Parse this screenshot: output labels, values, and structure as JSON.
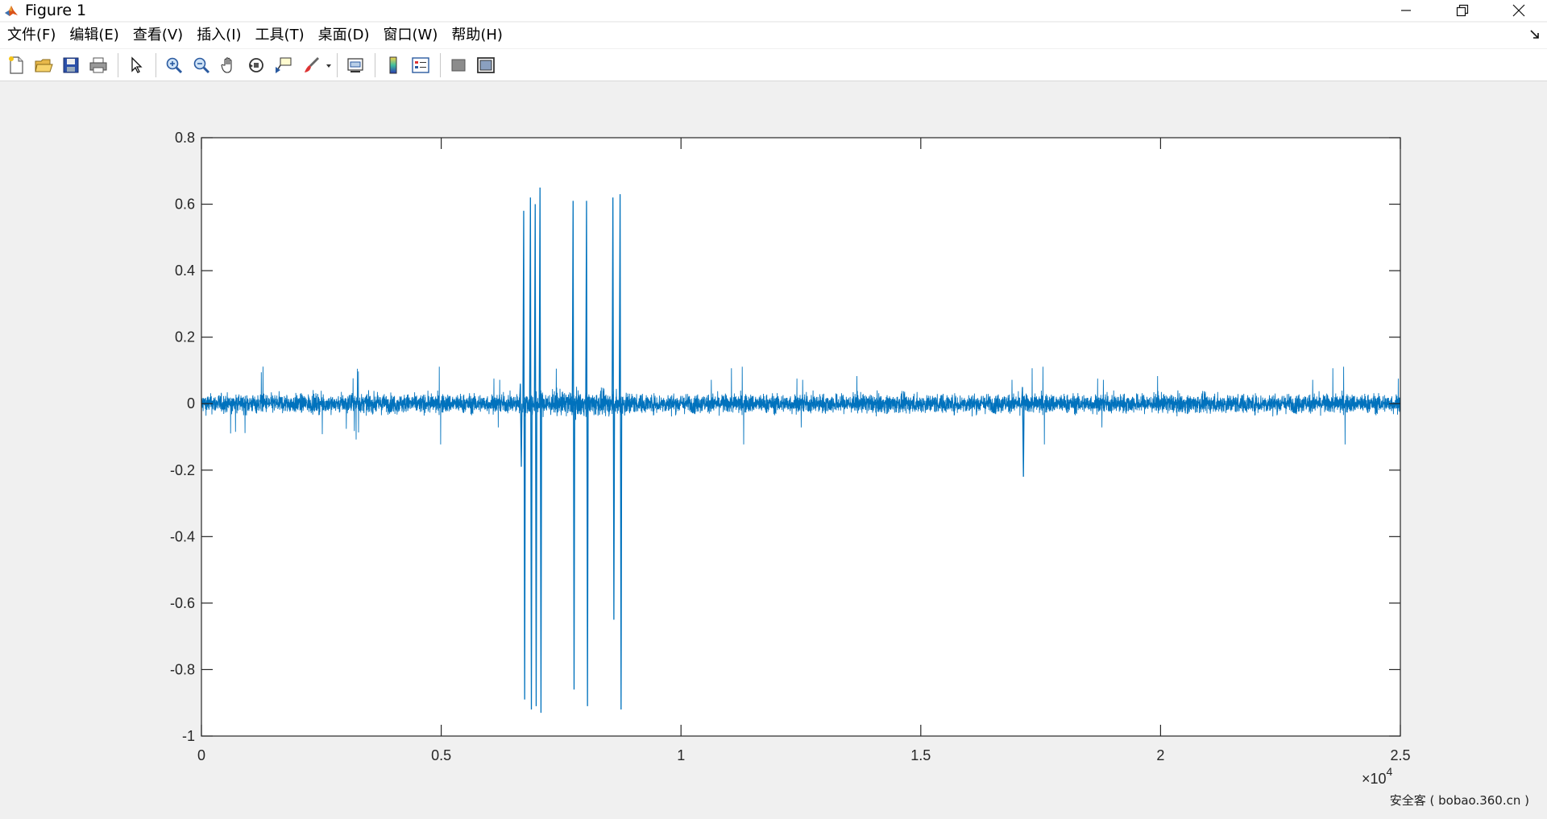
{
  "window": {
    "title": "Figure 1",
    "app_icon": "matlab-icon",
    "controls": [
      "minimize-icon",
      "restore-icon",
      "close-icon"
    ]
  },
  "menu": {
    "items": [
      {
        "label": "文件(F)"
      },
      {
        "label": "编辑(E)"
      },
      {
        "label": "查看(V)"
      },
      {
        "label": "插入(I)"
      },
      {
        "label": "工具(T)"
      },
      {
        "label": "桌面(D)"
      },
      {
        "label": "窗口(W)"
      },
      {
        "label": "帮助(H)"
      }
    ]
  },
  "toolbar": {
    "buttons": [
      "new-figure-icon",
      "open-file-icon",
      "save-icon",
      "print-icon",
      "separator",
      "edit-plot-arrow-icon",
      "separator",
      "zoom-in-icon",
      "zoom-out-icon",
      "pan-hand-icon",
      "rotate-3d-icon",
      "data-cursor-icon",
      "brush-icon",
      "separator",
      "link-plot-icon",
      "separator",
      "insert-colorbar-icon",
      "insert-legend-icon",
      "separator",
      "hide-plot-tools-icon",
      "show-plot-tools-icon"
    ]
  },
  "colors": {
    "series": "#0072bd",
    "axes": "#262626",
    "background": "#f0f0f0",
    "plot_bg": "#ffffff"
  },
  "chart_data": {
    "type": "line",
    "title": "",
    "xlabel": "",
    "ylabel": "",
    "xlim": [
      0,
      25000
    ],
    "ylim": [
      -1,
      0.8
    ],
    "xticks": [
      0,
      5000,
      10000,
      15000,
      20000,
      25000
    ],
    "xtick_labels": [
      "0",
      "0.5",
      "1",
      "1.5",
      "2",
      "2.5"
    ],
    "x_exponent_label": "×10",
    "x_exponent_power": "4",
    "yticks": [
      -1,
      -0.8,
      -0.6,
      -0.4,
      -0.2,
      0,
      0.2,
      0.4,
      0.6,
      0.8
    ],
    "ytick_labels": [
      "-1",
      "-0.8",
      "-0.6",
      "-0.4",
      "-0.2",
      "0",
      "0.2",
      "0.4",
      "0.6",
      "0.8"
    ],
    "grid": false,
    "legend": "none",
    "series": [
      {
        "noise_segments": [
          {
            "x_start": 0,
            "x_end": 6650,
            "amplitude": 0.055
          },
          {
            "x_start": 6700,
            "x_end": 9000,
            "amplitude": 0.07
          },
          {
            "x_start": 9000,
            "x_end": 25000,
            "amplitude": 0.055
          }
        ],
        "spikes": [
          {
            "x": 6650,
            "high": 0.06,
            "low": -0.19
          },
          {
            "x": 6720,
            "high": 0.58,
            "low": -0.89
          },
          {
            "x": 6860,
            "high": 0.62,
            "low": -0.92
          },
          {
            "x": 6960,
            "high": 0.6,
            "low": -0.91
          },
          {
            "x": 7060,
            "high": 0.65,
            "low": -0.93
          },
          {
            "x": 7750,
            "high": 0.61,
            "low": -0.86
          },
          {
            "x": 8030,
            "high": 0.61,
            "low": -0.91
          },
          {
            "x": 8580,
            "high": 0.62,
            "low": -0.65
          },
          {
            "x": 8730,
            "high": 0.63,
            "low": -0.92
          },
          {
            "x": 17120,
            "high": 0.05,
            "low": -0.22
          }
        ]
      }
    ]
  },
  "watermark": "安全客 ( bobao.360.cn )"
}
